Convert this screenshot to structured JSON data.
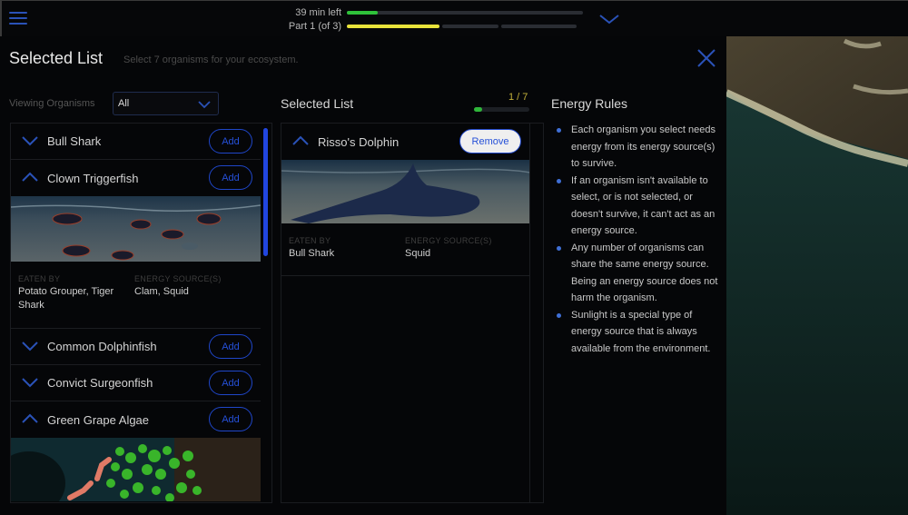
{
  "topbar": {
    "menu_icon": "hamburger-menu-icon",
    "time_left_label": "39 min left",
    "time_progress": 0.13,
    "part_label": "Part 1 (of 3)",
    "part_current": 1,
    "part_total": 3,
    "part_progress_in_current": 1.0,
    "collapse_icon": "chevron-down-icon",
    "colors": {
      "time": "#2fc23a",
      "part": "#e8e23a"
    }
  },
  "header": {
    "title": "Selected List",
    "subtitle": "Select 7 organisms for your ecosystem.",
    "close_icon": "close-icon"
  },
  "filter": {
    "label": "Viewing Organisms",
    "selected": "All"
  },
  "organism_list": {
    "items": [
      {
        "name": "Bull Shark",
        "expanded": false,
        "button": "Add"
      },
      {
        "name": "Clown Triggerfish",
        "expanded": true,
        "button": "Add",
        "eaten_by_label": "EATEN BY",
        "eaten_by": "Potato Grouper, Tiger Shark",
        "energy_label": "ENERGY SOURCE(S)",
        "energy_sources": "Clam, Squid"
      },
      {
        "name": "Common Dolphinfish",
        "expanded": false,
        "button": "Add"
      },
      {
        "name": "Convict Surgeonfish",
        "expanded": false,
        "button": "Add"
      },
      {
        "name": "Green Grape Algae",
        "expanded": true,
        "button": "Add"
      }
    ]
  },
  "selected_list": {
    "title": "Selected List",
    "count_label": "1 / 7",
    "selected": 1,
    "total": 7,
    "items": [
      {
        "name": "Risso's Dolphin",
        "expanded": true,
        "button": "Remove",
        "eaten_by_label": "EATEN BY",
        "eaten_by": "Bull Shark",
        "energy_label": "ENERGY SOURCE(S)",
        "energy_sources": "Squid"
      }
    ]
  },
  "energy_rules": {
    "title": "Energy Rules",
    "rules": [
      "Each organism you select needs energy from its energy source(s) to survive.",
      "If an organism isn't available to select, or is not selected, or doesn't survive, it can't act as an energy source.",
      "Any number of organisms can share the same energy source. Being an energy source does not harm the organism.",
      "Sunlight is a special type of energy source that is always available from the environment."
    ]
  },
  "accent_color": "#2550d8"
}
